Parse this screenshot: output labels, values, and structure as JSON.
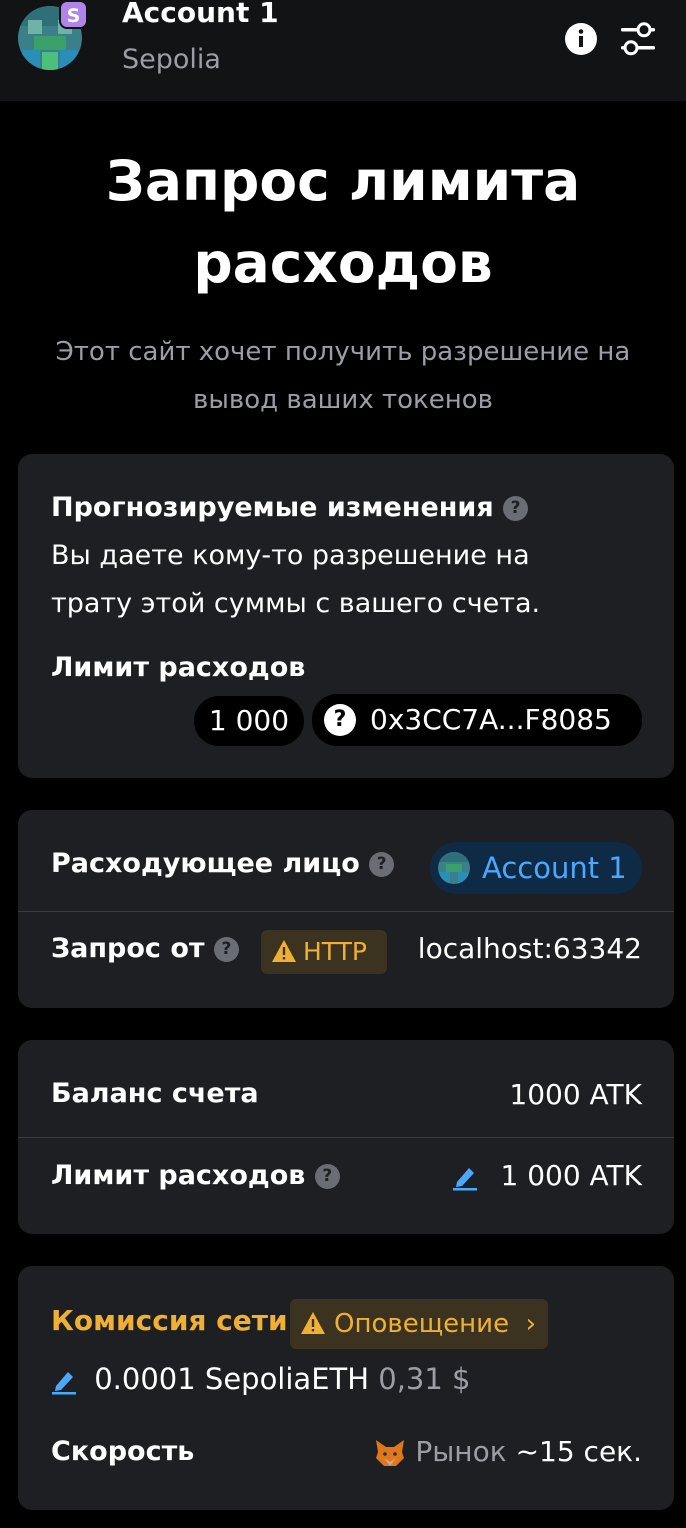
{
  "header": {
    "account_name": "Account 1",
    "network_name": "Sepolia",
    "network_badge": "S"
  },
  "title": "Запрос лимита расходов",
  "subtitle": "Этот сайт хочет получить разрешение на вывод ваших токенов",
  "estimated_changes": {
    "heading": "Прогнозируемые изменения",
    "description_line1": "Вы даете кому-то разрешение на",
    "description_line2": "трату этой суммы с вашего счета.",
    "spending_limit_label": "Лимит расходов",
    "amount": "1 000",
    "token_address": "0x3CC7A...F8085"
  },
  "spender": {
    "spender_label": "Расходующее лицо",
    "spender_value": "Account 1",
    "request_from_label": "Запрос от",
    "http_label": "HTTP",
    "origin": "localhost:63342"
  },
  "balance": {
    "balance_label": "Баланс счета",
    "balance_value": "1000 ATK",
    "limit_label": "Лимит расходов",
    "limit_value": "1 000 ATK"
  },
  "network_fee": {
    "label": "Комиссия сети",
    "alert_label": "Оповещение",
    "chevron": "›",
    "fee_amount": "0.0001 SepoliaETH",
    "fee_fiat": "0,31 $",
    "speed_label": "Скорость",
    "speed_mode": "Рынок",
    "speed_time": "~15 сек."
  },
  "colors": {
    "background": "#000000",
    "card": "#1e1f22",
    "accent_blue": "#4ba8ff",
    "warning": "#f0b034",
    "muted": "#9b9ea5"
  },
  "icons": [
    "info-icon",
    "settings-sliders-icon",
    "question-icon",
    "warning-icon",
    "edit-icon",
    "fox-icon",
    "chevron-right-icon"
  ]
}
